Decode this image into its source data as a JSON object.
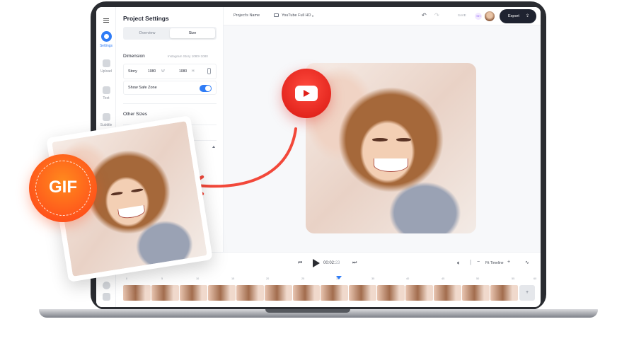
{
  "rail": [
    {
      "label": "Settings",
      "active": true
    },
    {
      "label": "Upload",
      "active": false
    },
    {
      "label": "Text",
      "active": false
    },
    {
      "label": "Subtitle",
      "active": false
    }
  ],
  "panel": {
    "title": "Project Settings",
    "tabs": [
      "Overview",
      "Size"
    ],
    "dimension_label": "Dimension",
    "dimension_hint": "Instagram Story 1080×1080",
    "story_label": "Story",
    "width_value": "1080",
    "width_unit": "W",
    "height_value": "1080",
    "height_unit": "H",
    "safe_zone_label": "Show Safe Zone",
    "other_sizes_label": "Other Sizes"
  },
  "topbar": {
    "project_name": "Project's Name",
    "format": "YouTube Full HD",
    "saving": "SAVE",
    "badge": "SH",
    "export_label": "Export"
  },
  "transport": {
    "timecode": "00:02:",
    "timecode_frames": "23",
    "fit_label": "Fit Timeline"
  },
  "ruler_ticks": [
    "0",
    "5",
    "10",
    "15",
    "20",
    "25",
    "30",
    "35",
    "40",
    "45",
    "50",
    "55",
    "60"
  ],
  "badges": {
    "gif": "GIF"
  }
}
